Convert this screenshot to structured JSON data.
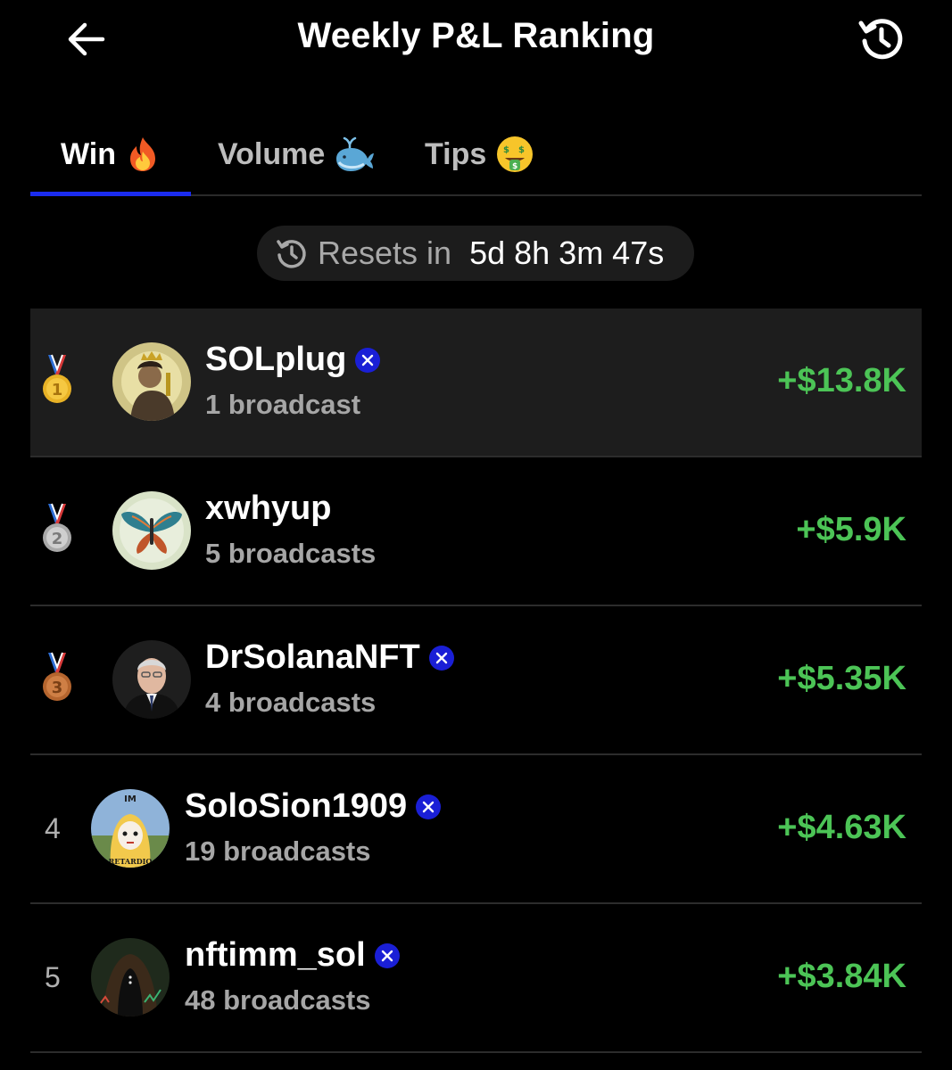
{
  "header": {
    "title": "Weekly P&L Ranking",
    "back_icon": "arrow-left-icon",
    "history_icon": "history-icon"
  },
  "tabs": [
    {
      "label": "Win",
      "emoji": "🔥",
      "active": true
    },
    {
      "label": "Volume",
      "emoji": "🐳",
      "active": false
    },
    {
      "label": "Tips",
      "emoji": "🤑",
      "active": false
    }
  ],
  "reset": {
    "label": "Resets in",
    "value": "5d 8h 3m 47s"
  },
  "rankings": [
    {
      "rank": "1",
      "name": "SOLplug",
      "verified": true,
      "broadcasts": "1 broadcast",
      "pnl": "+$13.8K"
    },
    {
      "rank": "2",
      "name": "xwhyup",
      "verified": false,
      "broadcasts": "5 broadcasts",
      "pnl": "+$5.9K"
    },
    {
      "rank": "3",
      "name": "DrSolanaNFT",
      "verified": true,
      "broadcasts": "4 broadcasts",
      "pnl": "+$5.35K"
    },
    {
      "rank": "4",
      "name": "SoloSion1909",
      "verified": true,
      "broadcasts": "19 broadcasts",
      "pnl": "+$4.63K"
    },
    {
      "rank": "5",
      "name": "nftimm_sol",
      "verified": true,
      "broadcasts": "48 broadcasts",
      "pnl": "+$3.84K"
    }
  ],
  "avatar_text": {
    "rank4_top": "IM",
    "rank4_bottom": "RETARDIO"
  },
  "colors": {
    "background": "#000000",
    "accent": "#1b2cf0",
    "positive": "#4cc456",
    "verified": "#1a1fd6",
    "gold": "#e8b226",
    "silver": "#a9a9a9",
    "bronze": "#b5652e"
  }
}
